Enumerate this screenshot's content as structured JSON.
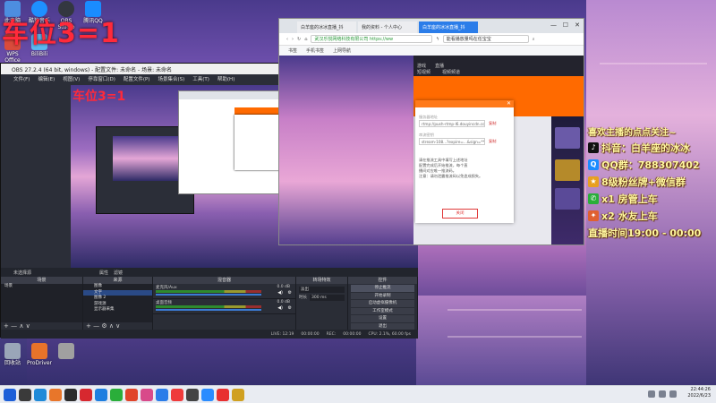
{
  "stream_title": "车位3=1",
  "desktop_icons": {
    "col1": [
      {
        "label": "此电脑",
        "color": "#4d8ee0"
      },
      {
        "label": "WPS Office",
        "color": "#d94b3b"
      },
      {
        "label": "",
        "color": "#e24c3c"
      },
      {
        "label": "",
        "color": "#3d7ed9"
      },
      {
        "label": "回收站",
        "color": "#9aa6b8"
      }
    ],
    "col2": [
      {
        "label": "酷狗音乐",
        "color": "#1e90ff"
      },
      {
        "label": "BiliBili",
        "color": "#5bb8f0"
      },
      {
        "label": "ProDriver",
        "color": "#e8732a"
      }
    ],
    "col3": [
      {
        "label": "OBS Studio",
        "color": "#333740"
      },
      {
        "label": "",
        "color": "#a0a0a0"
      }
    ],
    "col4": [
      {
        "label": "腾讯QQ",
        "color": "#1a8cff"
      },
      {
        "label": "",
        "color": "#e63a3a"
      }
    ]
  },
  "info_panel": {
    "headline": "喜欢主播的点点关注~",
    "rows": [
      {
        "icon": "tiktok-icon",
        "text": "抖音：白羊座的冰冰",
        "color": "#111"
      },
      {
        "icon": "qq-icon",
        "text": "QQ群：788307402",
        "color": "#1a8cff"
      },
      {
        "icon": "fan-badge-icon",
        "text": "8级粉丝牌+微信群",
        "color": "#e8a020"
      },
      {
        "icon": "wechat-icon",
        "text": "x1 房管上车",
        "color": "#2aae3a"
      },
      {
        "icon": "gift-icon",
        "text": "x2 水友上车",
        "color": "#e06030"
      },
      {
        "icon": "",
        "text": "直播时间19:00 - 00:00",
        "color": ""
      }
    ]
  },
  "obs": {
    "title": "OBS 27.2.4 (64 bit, windows) - 配置文件: 未命名 - 场景: 未命名",
    "menu": [
      "文件(F)",
      "编辑(E)",
      "视图(V)",
      "停靠窗口(D)",
      "配置文件(P)",
      "场景集合(S)",
      "工具(T)",
      "帮助(H)"
    ],
    "preview_nested_title": "车位3=1",
    "status_left": "未选择源",
    "status_props": "属性",
    "status_filters": "滤镜",
    "docks": {
      "scenes": {
        "header": "场景",
        "items": [
          "场景"
        ],
        "footer": "+ — ∧ ∨"
      },
      "sources": {
        "header": "来源",
        "items": [
          "图像",
          "文字",
          "图像 2",
          "游戏源",
          "显示器采集"
        ],
        "footer": "+ — ⚙ ∧ ∨"
      },
      "mixer": {
        "header": "混音器",
        "channels": [
          {
            "name": "麦克风/Aux",
            "db": "0.0 dB"
          },
          {
            "name": "桌面音频",
            "db": "0.0 dB"
          }
        ]
      },
      "transitions": {
        "header": "转场特效",
        "type": "淡出",
        "duration_label": "时长",
        "duration": "300 ms"
      },
      "controls": {
        "header": "控件",
        "buttons": [
          "停止推流",
          "开始录制",
          "启动虚拟摄像机",
          "工作室模式",
          "设置",
          "退出"
        ]
      }
    },
    "bottom": {
      "live": "LIVE: 12:19",
      "live_time": "00:00:00",
      "rec": "REC:",
      "rec_time": "00:00:00",
      "cpu": "CPU: 2.1%, 60.00 fps"
    }
  },
  "browser": {
    "tabs": [
      "白羊座的冰冰直播_抖",
      "我的资料 - 个人中心",
      "白羊座的冰冰直播_抖"
    ],
    "url": "武汉乐悦网络科技有限公司  https://ww",
    "search_text": "能看播放量吗在任宝宝",
    "favorites": [
      "书签",
      "手机书签",
      "上网导航"
    ],
    "header_links": [
      "游戏",
      "直播",
      "短视频",
      "视频频道"
    ],
    "modal": {
      "server_label": "服务器地址",
      "server_value": "rtmp://push-rtmp-l6.douyincdn.com/live",
      "key_label": "串流密钥",
      "key_value": "stream-108...?expire=...&sign=*****",
      "copy": "复制",
      "tip1": "请在推流工具中填写上述地址",
      "tip2": "配置完成后开始推流，每个直",
      "tip3": "播间对应唯一推流码。",
      "tip4": "注意：请勿泄露推流码以免造成损失。",
      "close": "关闭"
    }
  },
  "taskbar": {
    "icons": [
      "#1d5fd8",
      "#3a3a3a",
      "#1f8ad8",
      "#e8762a",
      "#2c2c2c",
      "#d7282f",
      "#1e7fe0",
      "#2aae3a",
      "#e0452a",
      "#d84a8a",
      "#2b7de9",
      "#ef3b3b",
      "#444",
      "#2a8cff",
      "#e83030",
      "#d0a020"
    ],
    "time": "22:44:26",
    "date": "2022/6/23"
  }
}
